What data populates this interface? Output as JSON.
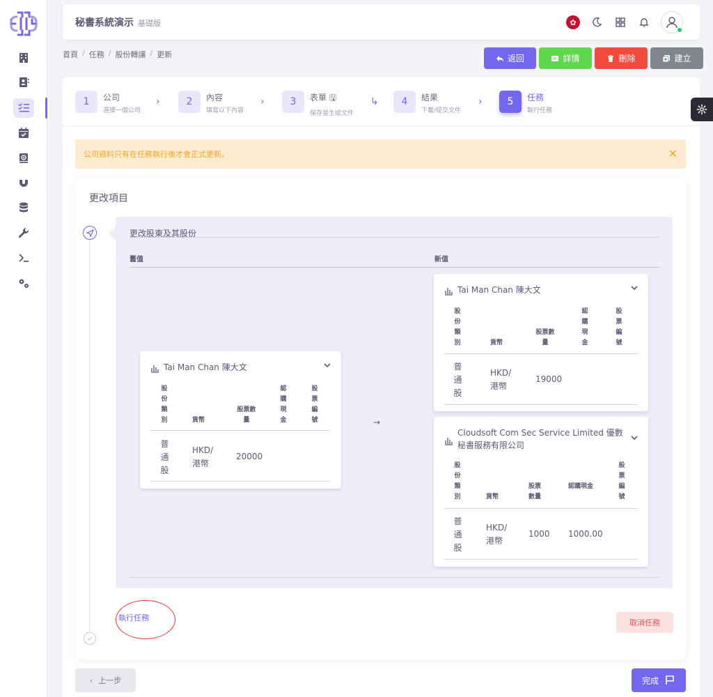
{
  "app": {
    "title": "秘書系統演示",
    "subtitle": "基礎版"
  },
  "header": {
    "flag_icon": "hk-flag-icon",
    "icons": [
      "moon-icon",
      "grid-icon",
      "bell-icon",
      "user-avatar"
    ]
  },
  "breadcrumb": [
    "首頁",
    "任務",
    "股份轉讓",
    "更新"
  ],
  "actions": {
    "back": "返回",
    "detail": "詳情",
    "delete": "刪除",
    "create": "建立"
  },
  "steps": [
    {
      "num": "1",
      "title": "公司",
      "sub": "選擇一個公司"
    },
    {
      "num": "2",
      "title": "內容",
      "sub": "填寫以下內容"
    },
    {
      "num": "3",
      "title": "表單",
      "sub": "保存並生成文件"
    },
    {
      "num": "4",
      "title": "結果",
      "sub": "下載/提交文件"
    },
    {
      "num": "5",
      "title": "任務",
      "sub": "執行任務"
    }
  ],
  "alert": "公司資料只有在任務執行後才會正式更新。",
  "changes": {
    "title": "更改項目",
    "item_label": "更改股東及其股份",
    "old_header": "舊值",
    "new_header": "新值",
    "arrow": "→"
  },
  "old_holder": {
    "name": "Tai Man Chan 陳大文",
    "col_share_class": "股份類別",
    "col_currency": "貨幣",
    "col_qty": "股票數量",
    "col_cash": "認購現金",
    "col_cert": "股票編號",
    "share_class": "普通股",
    "currency": "HKD/港幣",
    "qty": "20000",
    "cash": "",
    "cert": ""
  },
  "new_holders": [
    {
      "name": "Tai Man Chan 陳大文",
      "col_share_class": "股份類別",
      "col_currency": "貨幣",
      "col_qty": "股票數量",
      "col_cash": "認購現金",
      "col_cert": "股票編號",
      "share_class": "普通股",
      "currency": "HKD/港幣",
      "qty": "19000",
      "cash": "",
      "cert": ""
    },
    {
      "name": "Cloudsoft Com Sec Service Limited 優數秘書服務有限公司",
      "col_share_class": "股份類別",
      "col_currency": "貨幣",
      "col_qty": "股票數量",
      "col_cash": "認購現金",
      "col_cert": "股票編號",
      "share_class": "普通股",
      "currency": "HKD/港幣",
      "qty": "1000",
      "cash": "1000.00",
      "cert": ""
    }
  ],
  "buttons": {
    "execute": "執行任務",
    "cancel": "取消任務",
    "prev": "上一步",
    "done": "完成"
  },
  "colors": {
    "primary": "#7367f0",
    "success": "#5fd84d",
    "danger": "#f24b3e",
    "secondary": "#80868c",
    "warning": "#f5a623"
  }
}
